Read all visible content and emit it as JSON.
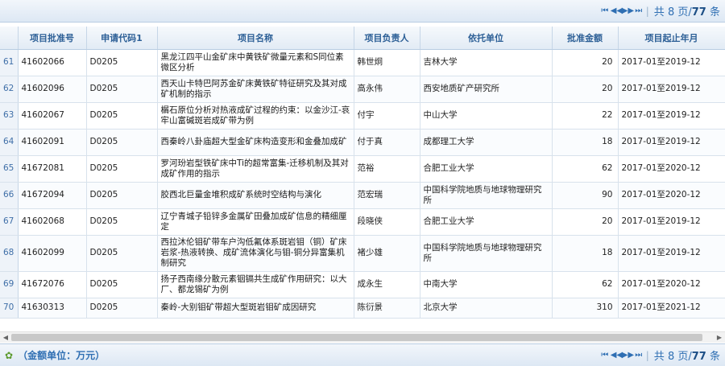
{
  "pager": {
    "first": "⏮",
    "prev": "◀◀",
    "next": "▶▶",
    "last": "⏭",
    "total_prefix": "共",
    "pages": "8",
    "pages_suffix": "页/",
    "records": "77",
    "records_suffix": "条"
  },
  "footer": {
    "note": "（金额单位：万元）",
    "icon": "refresh-icon"
  },
  "columns": [
    "",
    "项目批准号",
    "申请代码1",
    "项目名称",
    "项目负责人",
    "依托单位",
    "批准金额",
    "项目起止年月"
  ],
  "rows": [
    {
      "n": "61",
      "id": "41602066",
      "code": "D0205",
      "title": "黑龙江四平山金矿床中黄铁矿微量元素和S同位素微区分析",
      "pi": "韩世炯",
      "org": "吉林大学",
      "amount": "20",
      "period": "2017-01至2019-12"
    },
    {
      "n": "62",
      "id": "41602096",
      "code": "D0205",
      "title": "西天山卡特巴阿苏金矿床黄铁矿特征研究及其对成矿机制的指示",
      "pi": "高永伟",
      "org": "西安地质矿产研究所",
      "amount": "20",
      "period": "2017-01至2019-12"
    },
    {
      "n": "63",
      "id": "41602067",
      "code": "D0205",
      "title": "榍石原位分析对热液成矿过程的约束：以金沙江-哀牢山富碱斑岩成矿带为例",
      "pi": "付宇",
      "org": "中山大学",
      "amount": "22",
      "period": "2017-01至2019-12"
    },
    {
      "n": "64",
      "id": "41602091",
      "code": "D0205",
      "title": "西秦岭八卦庙超大型金矿床构造变形和金叠加成矿",
      "pi": "付于真",
      "org": "成都理工大学",
      "amount": "18",
      "period": "2017-01至2019-12"
    },
    {
      "n": "65",
      "id": "41672081",
      "code": "D0205",
      "title": "罗河玢岩型铁矿床中Ti的超常富集-迁移机制及其对成矿作用的指示",
      "pi": "范裕",
      "org": "合肥工业大学",
      "amount": "62",
      "period": "2017-01至2020-12"
    },
    {
      "n": "66",
      "id": "41672094",
      "code": "D0205",
      "title": "胶西北巨量金堆积成矿系统时空结构与演化",
      "pi": "范宏瑞",
      "org": "中国科学院地质与地球物理研究所",
      "amount": "90",
      "period": "2017-01至2020-12"
    },
    {
      "n": "67",
      "id": "41602068",
      "code": "D0205",
      "title": "辽宁青城子铅锌多金属矿田叠加成矿信息的精细厘定",
      "pi": "段晓侠",
      "org": "合肥工业大学",
      "amount": "20",
      "period": "2017-01至2019-12"
    },
    {
      "n": "68",
      "id": "41602099",
      "code": "D0205",
      "title": "西拉沐伦钼矿带车户沟低氟体系斑岩钼（铜）矿床岩浆-热液转换、成矿流体演化与钼-铜分异富集机制研究",
      "pi": "褚少雄",
      "org": "中国科学院地质与地球物理研究所",
      "amount": "18",
      "period": "2017-01至2019-12"
    },
    {
      "n": "69",
      "id": "41672076",
      "code": "D0205",
      "title": "扬子西南缘分散元素铟镉共生成矿作用研究：以大厂、都龙锡矿为例",
      "pi": "成永生",
      "org": "中南大学",
      "amount": "62",
      "period": "2017-01至2020-12"
    },
    {
      "n": "70",
      "id": "41630313",
      "code": "D0205",
      "title": "秦岭-大别钼矿带超大型斑岩钼矿成因研究",
      "pi": "陈衍景",
      "org": "北京大学",
      "amount": "310",
      "period": "2017-01至2021-12"
    }
  ]
}
